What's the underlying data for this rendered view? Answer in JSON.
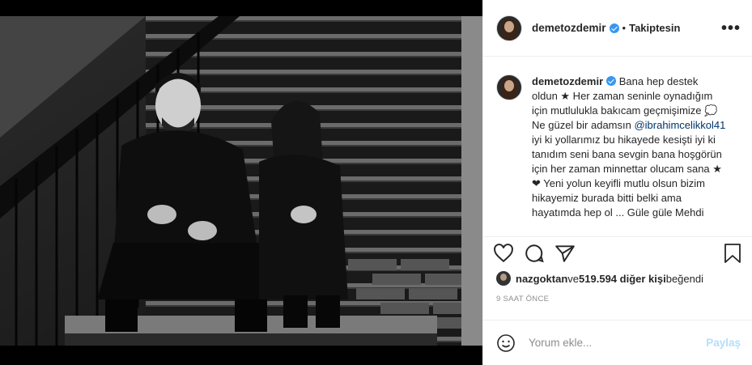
{
  "post": {
    "username": "demetozdemir",
    "separator": "•",
    "follow_status": "Takiptesin",
    "more_label": "•••"
  },
  "caption": {
    "username": "demetozdemir",
    "text_part1": " Bana hep destek oldun ★ Her zaman seninle oynadığım için mutlulukla bakıcam geçmişimize 💭Ne güzel bir adamsın ",
    "mention": "@ibrahimcelikkol41",
    "text_part2": " iyi ki yollarımız bu hikayede kesişti iyi ki tanıdım seni bana sevgin bana hoşgörün için her zaman minnettar olucam sana ★",
    "heart": "❤",
    "text_part3": " Yeni yolun keyifli mutlu olsun bizim hikayemiz burada bitti belki ama hayatımda hep ol ... Güle güle Mehdi"
  },
  "actions": {
    "like_icon": "heart-icon",
    "comment_icon": "comment-icon",
    "share_icon": "share-icon",
    "save_icon": "bookmark-icon"
  },
  "likes": {
    "first_liker": "nazgoktan",
    "conjunction": " ve ",
    "count_text": "519.594 diğer kişi",
    "suffix": " beğendi"
  },
  "timestamp": "9 SAAT ÖNCE",
  "comment_box": {
    "placeholder": "Yorum ekle...",
    "post_label": "Paylaş",
    "emoji_icon": "smiley-icon"
  },
  "colors": {
    "verified": "#3897f0",
    "mention": "#003569",
    "post_button_disabled": "#b2dffc",
    "muted_text": "#8e8e8e"
  }
}
